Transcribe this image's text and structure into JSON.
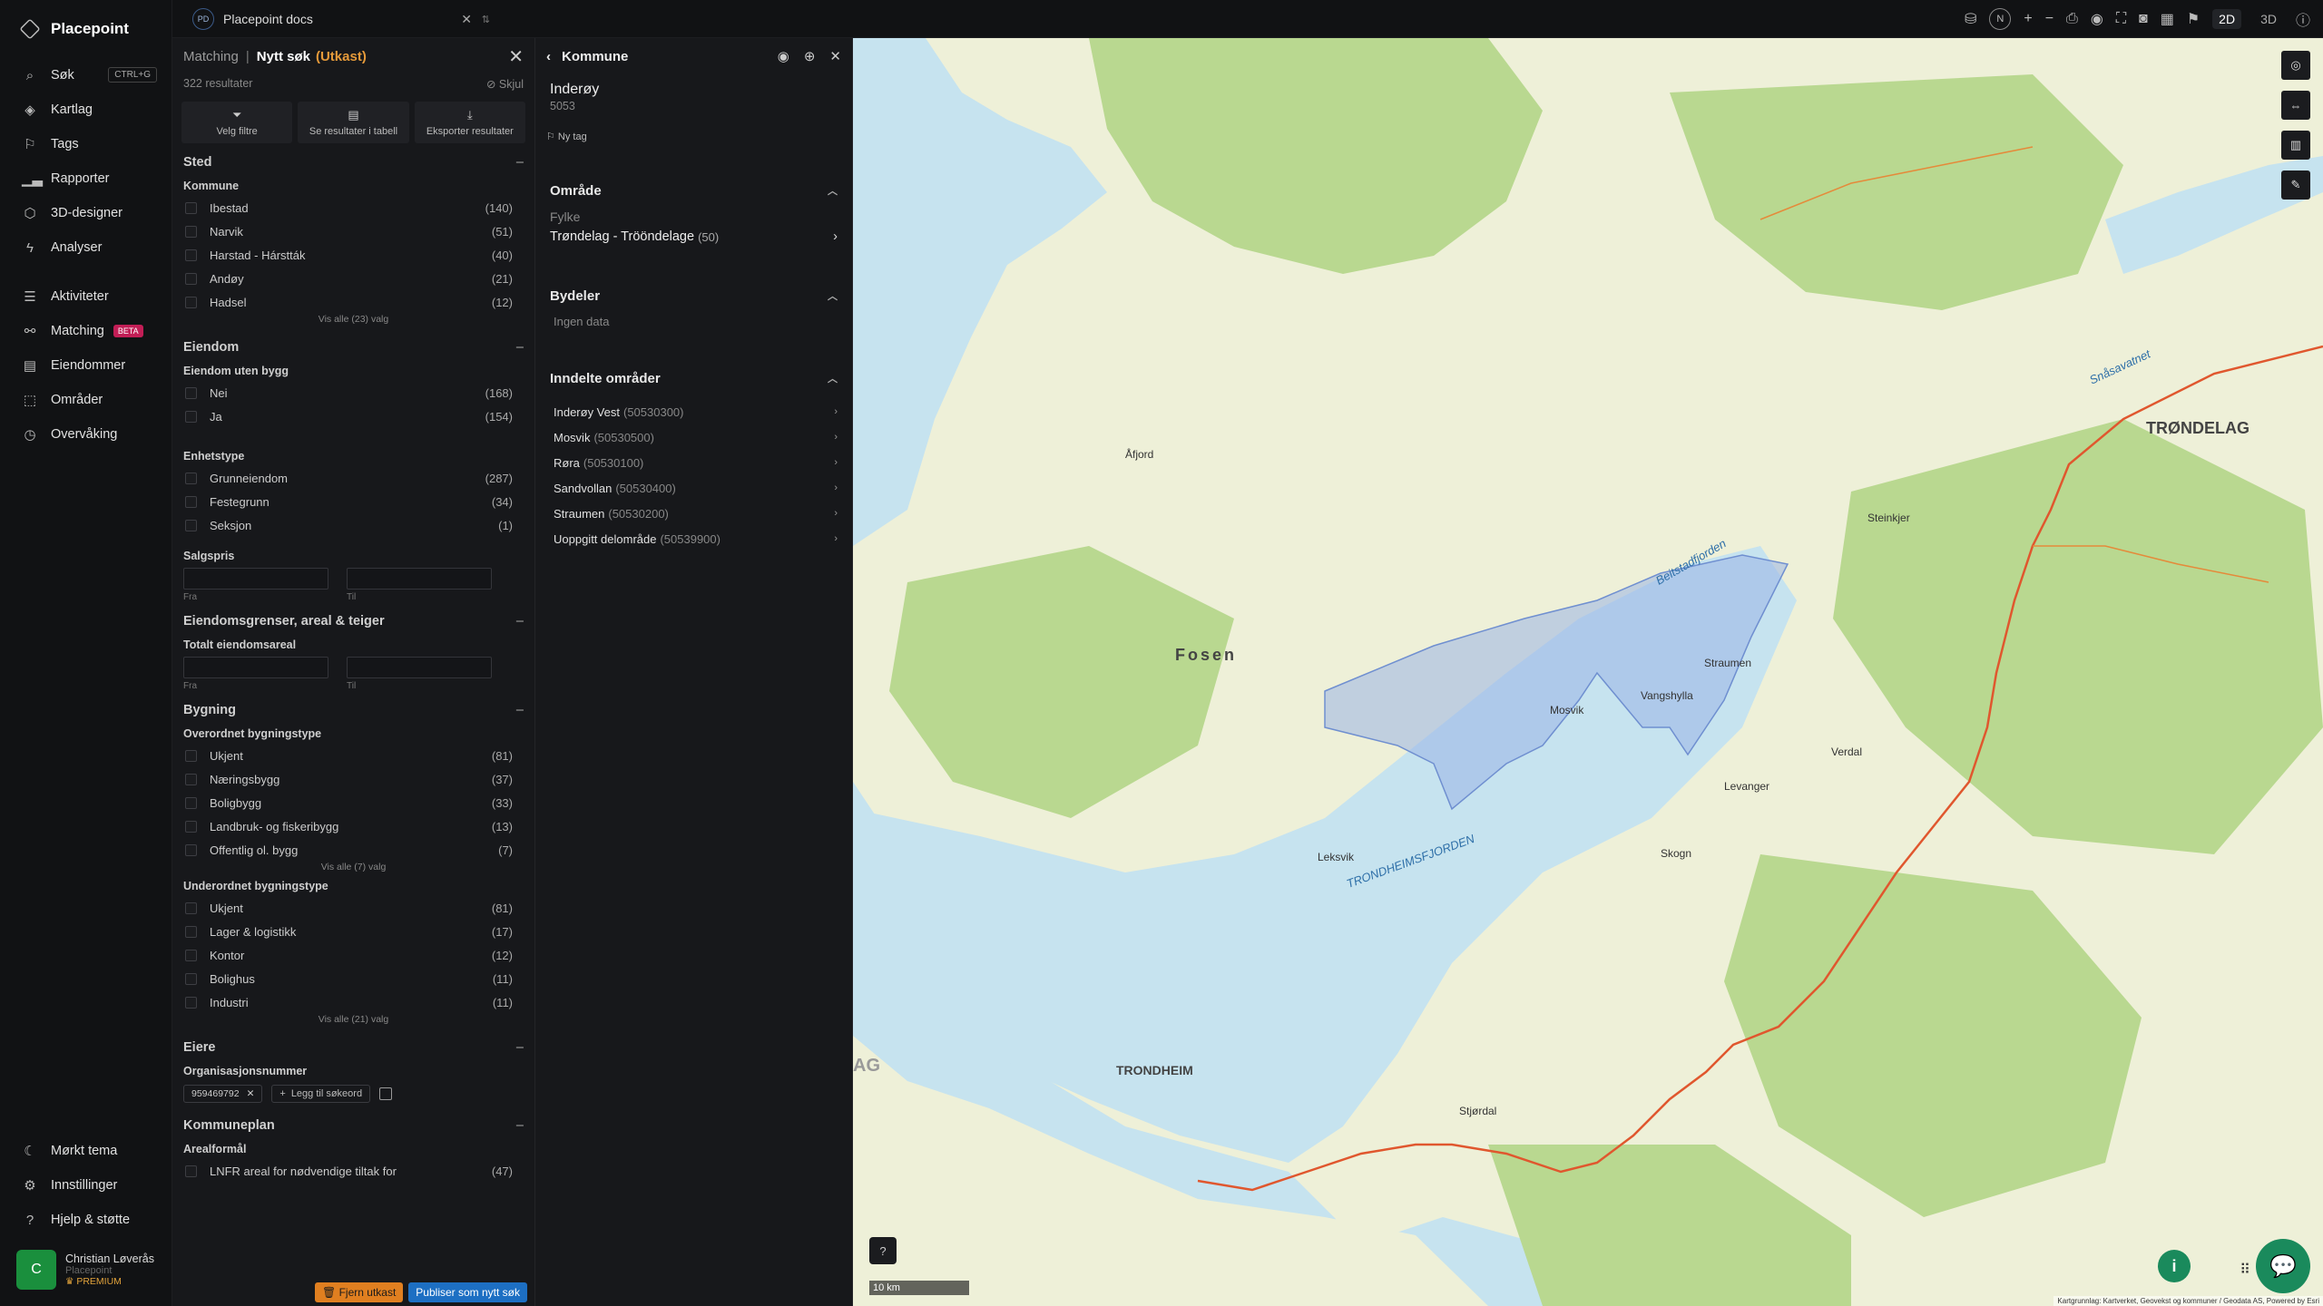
{
  "app": {
    "name": "Placepoint"
  },
  "nav": {
    "items": [
      {
        "label": "Søk",
        "shortcut": "CTRL+G",
        "icon": "search-icon"
      },
      {
        "label": "Kartlag",
        "icon": "layers-icon"
      },
      {
        "label": "Tags",
        "icon": "bookmark-icon"
      },
      {
        "label": "Rapporter",
        "icon": "chart-icon"
      },
      {
        "label": "3D-designer",
        "icon": "cube-icon"
      },
      {
        "label": "Analyser",
        "icon": "bolt-icon"
      }
    ],
    "items2": [
      {
        "label": "Aktiviteter",
        "icon": "activity-icon"
      },
      {
        "label": "Matching",
        "badge": "BETA",
        "icon": "matching-icon"
      },
      {
        "label": "Eiendommer",
        "icon": "property-icon"
      },
      {
        "label": "Områder",
        "icon": "area-icon"
      },
      {
        "label": "Overvåking",
        "icon": "monitor-icon"
      }
    ],
    "bottom": [
      {
        "label": "Mørkt tema",
        "icon": "moon-icon"
      },
      {
        "label": "Innstillinger",
        "icon": "gear-icon"
      },
      {
        "label": "Hjelp & støtte",
        "icon": "help-icon"
      }
    ],
    "user": {
      "initial": "C",
      "name": "Christian Løverås",
      "org": "Placepoint",
      "plan": "PREMIUM"
    }
  },
  "topbar": {
    "tab": {
      "badge": "PD",
      "title": "Placepoint docs"
    },
    "mode_2d": "2D",
    "mode_3d": "3D",
    "compass": "N"
  },
  "search": {
    "crumb_parent": "Matching",
    "crumb_current": "Nytt søk",
    "crumb_status": "(Utkast)",
    "result_count": "322 resultater",
    "hide_label": "Skjul",
    "actions": [
      "Velg filtre",
      "Se resultater i tabell",
      "Eksporter resultater"
    ],
    "sections": {
      "sted": {
        "title": "Sted",
        "kommune_label": "Kommune",
        "kommune": [
          {
            "name": "Ibestad",
            "count": "(140)"
          },
          {
            "name": "Narvik",
            "count": "(51)"
          },
          {
            "name": "Harstad - Hárstták",
            "count": "(40)"
          },
          {
            "name": "Andøy",
            "count": "(21)"
          },
          {
            "name": "Hadsel",
            "count": "(12)"
          }
        ],
        "show_all": "Vis alle (23) valg"
      },
      "eiendom": {
        "title": "Eiendom",
        "uten_bygg_label": "Eiendom uten bygg",
        "uten_bygg": [
          {
            "name": "Nei",
            "count": "(168)"
          },
          {
            "name": "Ja",
            "count": "(154)"
          }
        ],
        "enhetstype_label": "Enhetstype",
        "enhetstype": [
          {
            "name": "Grunneiendom",
            "count": "(287)"
          },
          {
            "name": "Festegrunn",
            "count": "(34)"
          },
          {
            "name": "Seksjon",
            "count": "(1)"
          }
        ],
        "salgspris_label": "Salgspris",
        "from": "Fra",
        "to": "Til"
      },
      "grenser": {
        "title": "Eiendomsgrenser, areal & teiger",
        "areal_label": "Totalt eiendomsareal",
        "from": "Fra",
        "to": "Til"
      },
      "bygning": {
        "title": "Bygning",
        "over_label": "Overordnet bygningstype",
        "over": [
          {
            "name": "Ukjent",
            "count": "(81)"
          },
          {
            "name": "Næringsbygg",
            "count": "(37)"
          },
          {
            "name": "Boligbygg",
            "count": "(33)"
          },
          {
            "name": "Landbruk- og fiskeribygg",
            "count": "(13)"
          },
          {
            "name": "Offentlig ol. bygg",
            "count": "(7)"
          }
        ],
        "over_show_all": "Vis alle (7) valg",
        "under_label": "Underordnet bygningstype",
        "under": [
          {
            "name": "Ukjent",
            "count": "(81)"
          },
          {
            "name": "Lager & logistikk",
            "count": "(17)"
          },
          {
            "name": "Kontor",
            "count": "(12)"
          },
          {
            "name": "Bolighus",
            "count": "(11)"
          },
          {
            "name": "Industri",
            "count": "(11)"
          }
        ],
        "under_show_all": "Vis alle (21) valg"
      },
      "eiere": {
        "title": "Eiere",
        "org_label": "Organisasjonsnummer",
        "chip": "959469792",
        "add_keyword": "Legg til søkeord"
      },
      "kommuneplan": {
        "title": "Kommuneplan",
        "arealformal_label": "Arealformål",
        "partial_row": {
          "name": "LNFR areal for nødvendige tiltak for",
          "count": "(47)"
        }
      }
    },
    "footer": {
      "remove_draft": "Fjern utkast",
      "publish": "Publiser som nytt søk"
    }
  },
  "kommune_panel": {
    "title": "Kommune",
    "name": "Inderøy",
    "number": "5053",
    "new_tag": "Ny tag",
    "omrade_title": "Område",
    "fylke_label": "Fylke",
    "fylke_value": "Trøndelag - Trööndelage",
    "fylke_count": "(50)",
    "bydeler_title": "Bydeler",
    "bydeler_empty": "Ingen data",
    "inndelte_title": "Inndelte områder",
    "inndelte": [
      {
        "name": "Inderøy Vest",
        "code": "(50530300)"
      },
      {
        "name": "Mosvik",
        "code": "(50530500)"
      },
      {
        "name": "Røra",
        "code": "(50530100)"
      },
      {
        "name": "Sandvollan",
        "code": "(50530400)"
      },
      {
        "name": "Straumen",
        "code": "(50530200)"
      },
      {
        "name": "Uoppgitt delområde",
        "code": "(50539900)"
      }
    ]
  },
  "map": {
    "scale": "10 km",
    "attribution": "Kartgrunnlag: Kartverket, Geovekst og kommuner / Geodata AS, Powered by Esri",
    "labels": {
      "trondelag": "TRØNDELAG",
      "fosen": "Fosen",
      "trondheim": "TRONDHEIM",
      "trondheimsfjorden": "TRONDHEIMSFJORDEN",
      "beitstadfjorden": "Beitstadfjorden",
      "snasavatnet": "Snåsavatnet",
      "steinkjer": "Steinkjer",
      "verdal": "Verdal",
      "levanger": "Levanger",
      "skogn": "Skogn",
      "stjordal": "Stjørdal",
      "leksvik": "Leksvik",
      "straumen": "Straumen",
      "vangshylla": "Vangshylla",
      "mosvik": "Mosvik",
      "afjord": "Åfjord",
      "ag": "AG"
    },
    "colors": {
      "water": "#c6e3ef",
      "land": "#eef0d8",
      "forest": "#b9d890",
      "selection": "#9ab4e6"
    }
  }
}
